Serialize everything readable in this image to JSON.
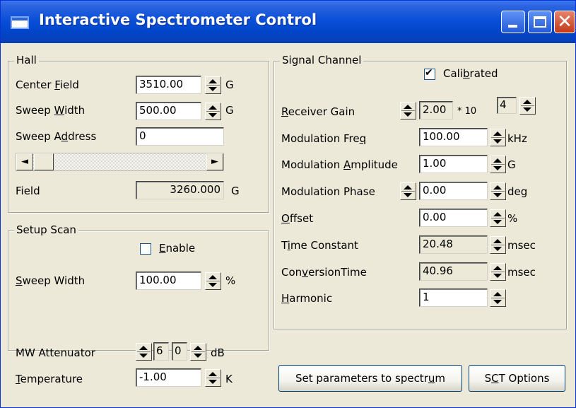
{
  "window": {
    "title": "Interactive Spectrometer Control"
  },
  "hall": {
    "legend": "Hall",
    "center_field": {
      "label": "Center Field",
      "value": "3510.00",
      "unit": "G"
    },
    "sweep_width": {
      "label": "Sweep Width",
      "value": "500.00",
      "unit": "G"
    },
    "sweep_address": {
      "label": "Sweep Address",
      "value": "0"
    },
    "field": {
      "label": "Field",
      "value": "3260.000",
      "unit": "G"
    },
    "scroll_left_glyph": "◄",
    "scroll_right_glyph": "►"
  },
  "setup_scan": {
    "legend": "Setup Scan",
    "enable": {
      "label": "Enable",
      "checked": false
    },
    "sweep_width": {
      "label": "Sweep Width",
      "value": "100.00",
      "unit": "%"
    }
  },
  "signal_channel": {
    "legend": "Signal Channel",
    "calibrated": {
      "label": "Calibrated",
      "checked": true
    },
    "receiver_gain": {
      "label": "Receiver Gain",
      "value": "2.00",
      "times": "* 10",
      "exponent": "4"
    },
    "mod_freq": {
      "label": "Modulation Freq",
      "value": "100.00",
      "unit": "kHz"
    },
    "mod_amp": {
      "label": "Modulation Amplitude",
      "value": "1.00",
      "unit": "G"
    },
    "mod_phase": {
      "label": "Modulation Phase",
      "value": "0.00",
      "unit": "deg"
    },
    "offset": {
      "label": "Offset",
      "value": "0.00",
      "unit": "%"
    },
    "time_constant": {
      "label": "Time  Constant",
      "value": "20.48",
      "unit": "msec"
    },
    "conversion_time": {
      "label": "ConversionTime",
      "value": "40.96",
      "unit": "msec"
    },
    "harmonic": {
      "label": "Harmonic",
      "value": "1"
    }
  },
  "bottom": {
    "mw_attenuator": {
      "label": "MW Attenuator",
      "value1": "6",
      "value2": "0",
      "unit": "dB"
    },
    "temperature": {
      "label": "Temperature",
      "value": "-1.00",
      "unit": "K"
    },
    "set_params_button": "Set parameters to spectrum",
    "sct_options_button": "SCT Options"
  },
  "colors": {
    "title_bar": "#0a50d8",
    "face": "#ece9d8",
    "close_button": "#c43a1b"
  },
  "icons": {
    "window": "app-window-icon",
    "check": "check-mark-icon"
  }
}
